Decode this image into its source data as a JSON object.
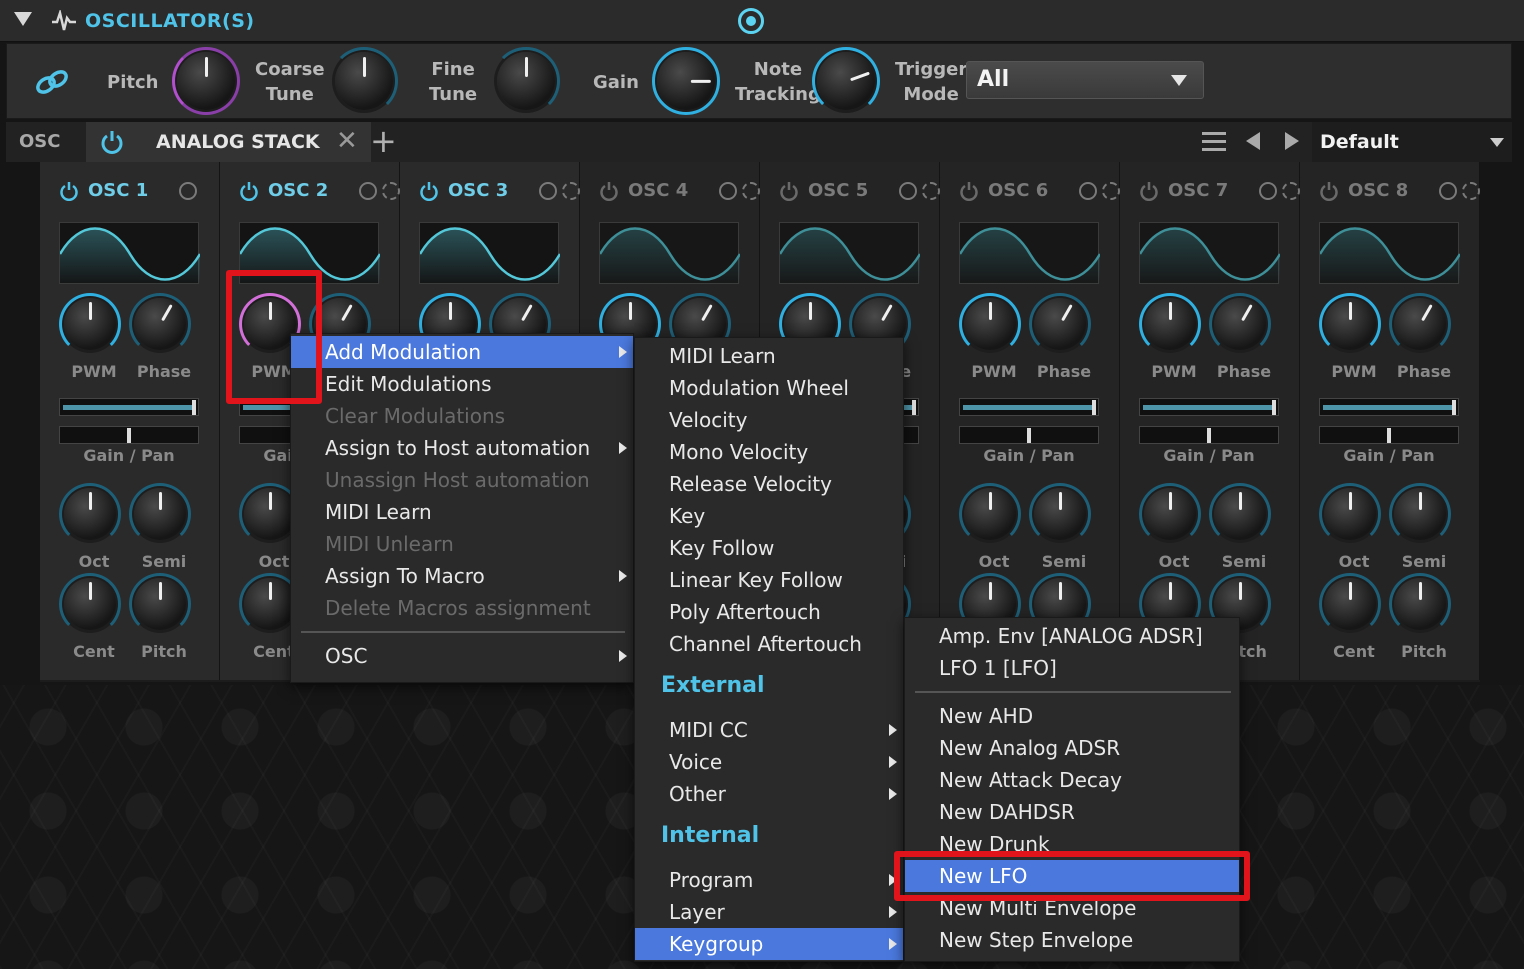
{
  "header": {
    "title": "OSCILLATOR(S)"
  },
  "master": {
    "pitch_label": "Pitch",
    "coarse_label_1": "Coarse",
    "coarse_label_2": "Tune",
    "fine_label_1": "Fine",
    "fine_label_2": "Tune",
    "gain_label": "Gain",
    "note_label_1": "Note",
    "note_label_2": "Tracking",
    "trigger_label_1": "Trigger",
    "trigger_label_2": "Mode",
    "trigger_value": "All"
  },
  "tabbar": {
    "osc_label": "OSC",
    "tab_name": "ANALOG STACK",
    "preset": "Default"
  },
  "oscillators": [
    {
      "name": "OSC 1",
      "active": true
    },
    {
      "name": "OSC 2",
      "active": true
    },
    {
      "name": "OSC 3",
      "active": true
    },
    {
      "name": "OSC 4",
      "active": false
    },
    {
      "name": "OSC 5",
      "active": false
    },
    {
      "name": "OSC 6",
      "active": false
    },
    {
      "name": "OSC 7",
      "active": false
    },
    {
      "name": "OSC 8",
      "active": false
    }
  ],
  "osc_labels": {
    "pwm": "PWM",
    "phase": "Phase",
    "gainpan": "Gain / Pan",
    "oct": "Oct",
    "semi": "Semi",
    "cent": "Cent",
    "pitch": "Pitch"
  },
  "menu1": {
    "items": [
      {
        "label": "Add Modulation",
        "state": "selected",
        "submenu": true
      },
      {
        "label": "Edit Modulations",
        "state": "enabled",
        "submenu": false
      },
      {
        "label": "Clear Modulations",
        "state": "disabled",
        "submenu": false
      },
      {
        "label": "Assign to Host automation",
        "state": "enabled",
        "submenu": true
      },
      {
        "label": "Unassign Host automation",
        "state": "disabled",
        "submenu": false
      },
      {
        "label": "MIDI Learn",
        "state": "enabled",
        "submenu": false
      },
      {
        "label": "MIDI Unlearn",
        "state": "disabled",
        "submenu": false
      },
      {
        "label": "Assign To Macro",
        "state": "enabled",
        "submenu": true
      },
      {
        "label": "Delete Macros assignment",
        "state": "disabled",
        "submenu": false
      }
    ],
    "osc_item": "OSC"
  },
  "menu2": {
    "items": [
      "MIDI Learn",
      "Modulation Wheel",
      "Velocity",
      "Mono Velocity",
      "Release Velocity",
      "Key",
      "Key Follow",
      "Linear Key Follow",
      "Poly Aftertouch",
      "Channel Aftertouch"
    ],
    "external_header": "External",
    "external_items": [
      "MIDI CC",
      "Voice",
      "Other"
    ],
    "internal_header": "Internal",
    "internal_items": [
      "Program",
      "Layer",
      "Keygroup"
    ]
  },
  "menu3": {
    "existing": [
      "Amp. Env [ANALOG ADSR]",
      "LFO 1 [LFO]"
    ],
    "new_items": [
      "New AHD",
      "New Analog ADSR",
      "New Attack Decay",
      "New DAHDSR",
      "New Drunk",
      "New LFO",
      "New Multi Envelope",
      "New Step Envelope"
    ]
  },
  "colors": {
    "accent": "#4fc3e8",
    "menu_selected": "#4a78dc",
    "highlight": "#e0141a"
  }
}
